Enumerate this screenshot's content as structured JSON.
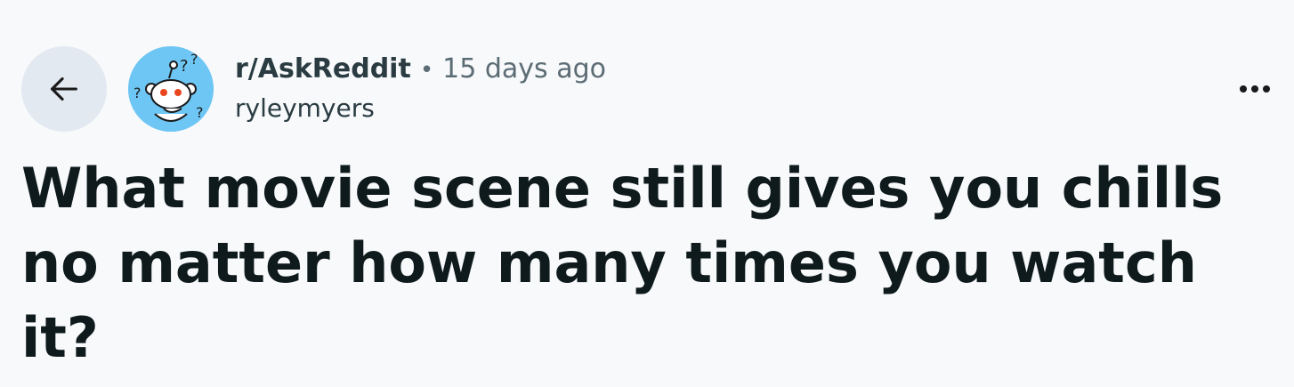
{
  "post": {
    "subreddit": "r/AskReddit",
    "separator": "•",
    "timestamp": "15 days ago",
    "author": "ryleymyers",
    "title": "What movie scene still gives you chills no matter how many times you watch it?"
  },
  "icons": {
    "back": "arrow-left-icon",
    "avatar": "snoo-avatar-icon",
    "overflow": "more-horizontal-icon"
  },
  "colors": {
    "background": "#f7f9fb",
    "back_button_bg": "#e3e9f1",
    "avatar_bg": "#6ec6f5",
    "title_text": "#0f1a1c",
    "meta_text": "#5c6c74"
  }
}
